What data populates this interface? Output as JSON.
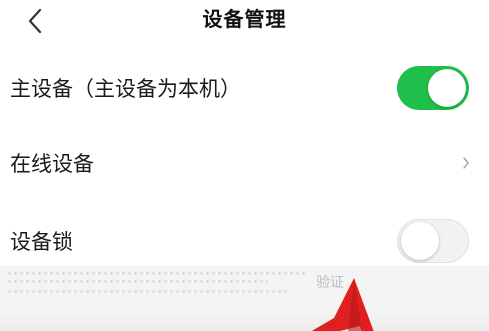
{
  "header": {
    "title": "设备管理",
    "back_icon": "chevron-left-icon"
  },
  "settings": {
    "main_device": {
      "label": "主设备（主设备为本机）",
      "toggle_on": true
    },
    "online_devices": {
      "label": "在线设备",
      "icon": "chevron-right-icon"
    },
    "device_lock": {
      "label": "设备锁",
      "toggle_on": false
    }
  },
  "footer": {
    "partial_text": "验证"
  },
  "colors": {
    "toggle_on": "#1fbf4b",
    "arrow": "#e02020"
  }
}
